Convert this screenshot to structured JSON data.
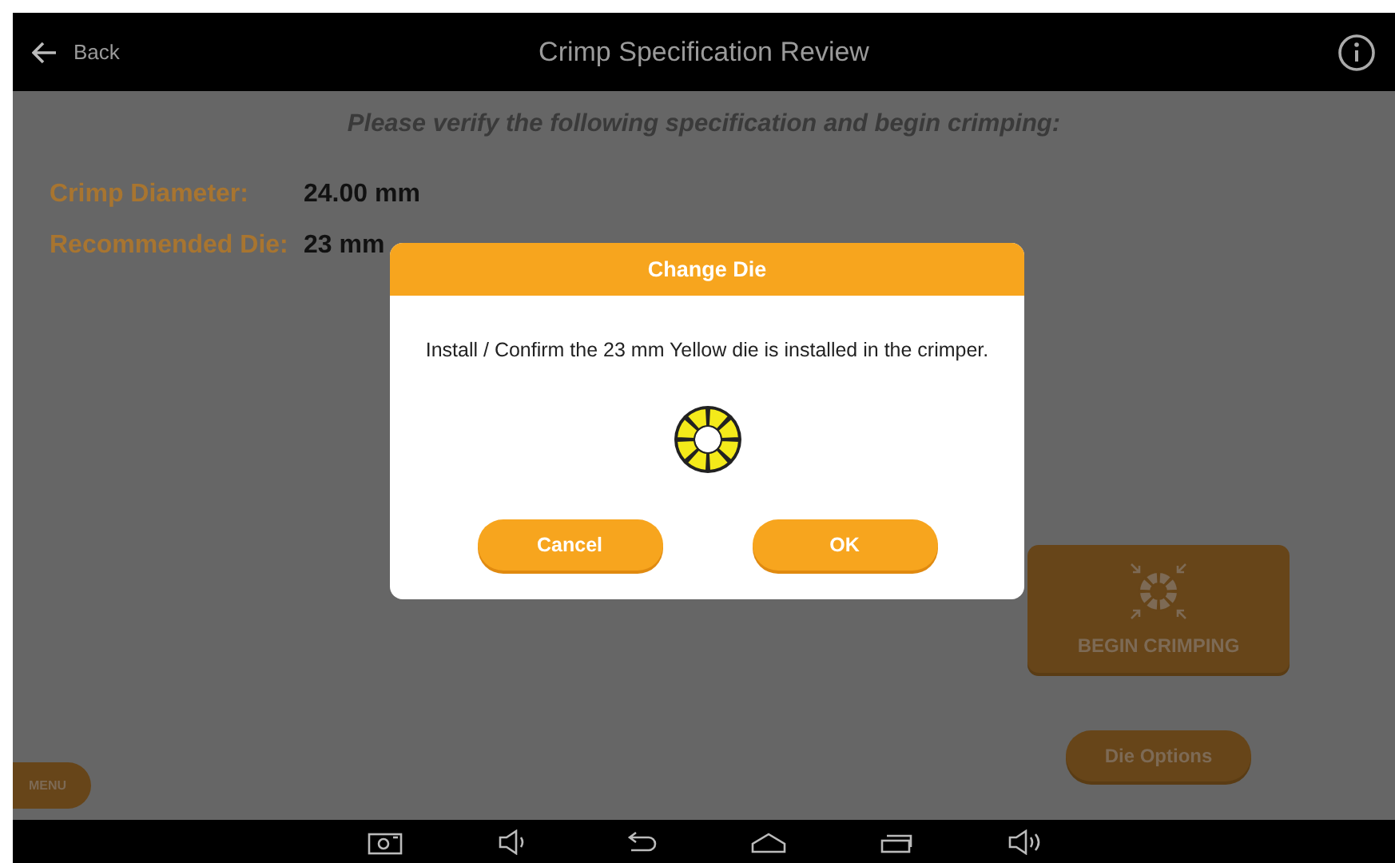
{
  "app_bar": {
    "back_label": "Back",
    "title": "Crimp Specification Review"
  },
  "instruction": "Please verify the following specification and begin crimping:",
  "specs": [
    {
      "label": "Crimp Diameter:",
      "value": "24.00 mm"
    },
    {
      "label": "Recommended Die:",
      "value": "23 mm"
    }
  ],
  "begin_button": {
    "label": "BEGIN CRIMPING"
  },
  "die_options_button": {
    "label": "Die Options"
  },
  "menu_button": {
    "label": "MENU"
  },
  "dialog": {
    "title": "Change Die",
    "message": "Install / Confirm the 23 mm Yellow die is installed in the crimper.",
    "buttons": [
      "Cancel",
      "OK"
    ]
  }
}
